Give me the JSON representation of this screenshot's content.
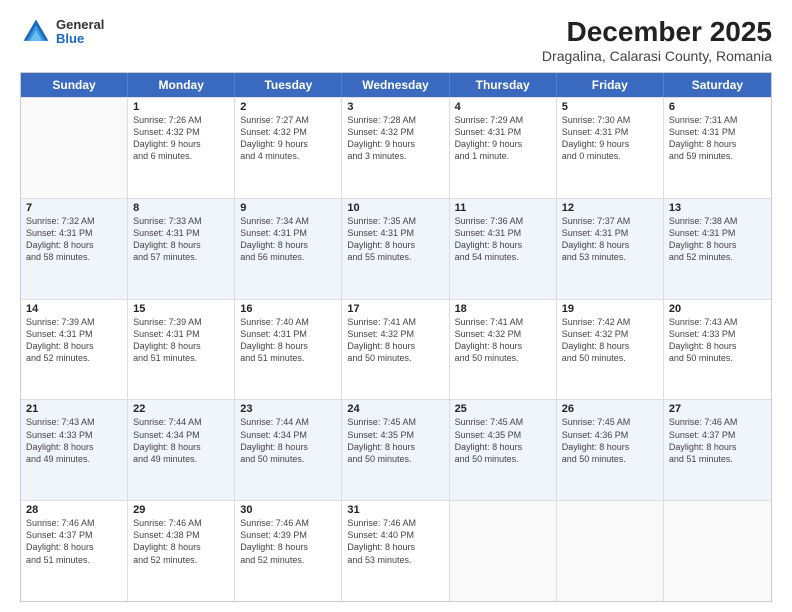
{
  "logo": {
    "general": "General",
    "blue": "Blue"
  },
  "title": "December 2025",
  "subtitle": "Dragalina, Calarasi County, Romania",
  "calendar": {
    "headers": [
      "Sunday",
      "Monday",
      "Tuesday",
      "Wednesday",
      "Thursday",
      "Friday",
      "Saturday"
    ],
    "rows": [
      [
        {
          "day": "",
          "lines": []
        },
        {
          "day": "1",
          "lines": [
            "Sunrise: 7:26 AM",
            "Sunset: 4:32 PM",
            "Daylight: 9 hours",
            "and 6 minutes."
          ]
        },
        {
          "day": "2",
          "lines": [
            "Sunrise: 7:27 AM",
            "Sunset: 4:32 PM",
            "Daylight: 9 hours",
            "and 4 minutes."
          ]
        },
        {
          "day": "3",
          "lines": [
            "Sunrise: 7:28 AM",
            "Sunset: 4:32 PM",
            "Daylight: 9 hours",
            "and 3 minutes."
          ]
        },
        {
          "day": "4",
          "lines": [
            "Sunrise: 7:29 AM",
            "Sunset: 4:31 PM",
            "Daylight: 9 hours",
            "and 1 minute."
          ]
        },
        {
          "day": "5",
          "lines": [
            "Sunrise: 7:30 AM",
            "Sunset: 4:31 PM",
            "Daylight: 9 hours",
            "and 0 minutes."
          ]
        },
        {
          "day": "6",
          "lines": [
            "Sunrise: 7:31 AM",
            "Sunset: 4:31 PM",
            "Daylight: 8 hours",
            "and 59 minutes."
          ]
        }
      ],
      [
        {
          "day": "7",
          "lines": [
            "Sunrise: 7:32 AM",
            "Sunset: 4:31 PM",
            "Daylight: 8 hours",
            "and 58 minutes."
          ]
        },
        {
          "day": "8",
          "lines": [
            "Sunrise: 7:33 AM",
            "Sunset: 4:31 PM",
            "Daylight: 8 hours",
            "and 57 minutes."
          ]
        },
        {
          "day": "9",
          "lines": [
            "Sunrise: 7:34 AM",
            "Sunset: 4:31 PM",
            "Daylight: 8 hours",
            "and 56 minutes."
          ]
        },
        {
          "day": "10",
          "lines": [
            "Sunrise: 7:35 AM",
            "Sunset: 4:31 PM",
            "Daylight: 8 hours",
            "and 55 minutes."
          ]
        },
        {
          "day": "11",
          "lines": [
            "Sunrise: 7:36 AM",
            "Sunset: 4:31 PM",
            "Daylight: 8 hours",
            "and 54 minutes."
          ]
        },
        {
          "day": "12",
          "lines": [
            "Sunrise: 7:37 AM",
            "Sunset: 4:31 PM",
            "Daylight: 8 hours",
            "and 53 minutes."
          ]
        },
        {
          "day": "13",
          "lines": [
            "Sunrise: 7:38 AM",
            "Sunset: 4:31 PM",
            "Daylight: 8 hours",
            "and 52 minutes."
          ]
        }
      ],
      [
        {
          "day": "14",
          "lines": [
            "Sunrise: 7:39 AM",
            "Sunset: 4:31 PM",
            "Daylight: 8 hours",
            "and 52 minutes."
          ]
        },
        {
          "day": "15",
          "lines": [
            "Sunrise: 7:39 AM",
            "Sunset: 4:31 PM",
            "Daylight: 8 hours",
            "and 51 minutes."
          ]
        },
        {
          "day": "16",
          "lines": [
            "Sunrise: 7:40 AM",
            "Sunset: 4:31 PM",
            "Daylight: 8 hours",
            "and 51 minutes."
          ]
        },
        {
          "day": "17",
          "lines": [
            "Sunrise: 7:41 AM",
            "Sunset: 4:32 PM",
            "Daylight: 8 hours",
            "and 50 minutes."
          ]
        },
        {
          "day": "18",
          "lines": [
            "Sunrise: 7:41 AM",
            "Sunset: 4:32 PM",
            "Daylight: 8 hours",
            "and 50 minutes."
          ]
        },
        {
          "day": "19",
          "lines": [
            "Sunrise: 7:42 AM",
            "Sunset: 4:32 PM",
            "Daylight: 8 hours",
            "and 50 minutes."
          ]
        },
        {
          "day": "20",
          "lines": [
            "Sunrise: 7:43 AM",
            "Sunset: 4:33 PM",
            "Daylight: 8 hours",
            "and 50 minutes."
          ]
        }
      ],
      [
        {
          "day": "21",
          "lines": [
            "Sunrise: 7:43 AM",
            "Sunset: 4:33 PM",
            "Daylight: 8 hours",
            "and 49 minutes."
          ]
        },
        {
          "day": "22",
          "lines": [
            "Sunrise: 7:44 AM",
            "Sunset: 4:34 PM",
            "Daylight: 8 hours",
            "and 49 minutes."
          ]
        },
        {
          "day": "23",
          "lines": [
            "Sunrise: 7:44 AM",
            "Sunset: 4:34 PM",
            "Daylight: 8 hours",
            "and 50 minutes."
          ]
        },
        {
          "day": "24",
          "lines": [
            "Sunrise: 7:45 AM",
            "Sunset: 4:35 PM",
            "Daylight: 8 hours",
            "and 50 minutes."
          ]
        },
        {
          "day": "25",
          "lines": [
            "Sunrise: 7:45 AM",
            "Sunset: 4:35 PM",
            "Daylight: 8 hours",
            "and 50 minutes."
          ]
        },
        {
          "day": "26",
          "lines": [
            "Sunrise: 7:45 AM",
            "Sunset: 4:36 PM",
            "Daylight: 8 hours",
            "and 50 minutes."
          ]
        },
        {
          "day": "27",
          "lines": [
            "Sunrise: 7:46 AM",
            "Sunset: 4:37 PM",
            "Daylight: 8 hours",
            "and 51 minutes."
          ]
        }
      ],
      [
        {
          "day": "28",
          "lines": [
            "Sunrise: 7:46 AM",
            "Sunset: 4:37 PM",
            "Daylight: 8 hours",
            "and 51 minutes."
          ]
        },
        {
          "day": "29",
          "lines": [
            "Sunrise: 7:46 AM",
            "Sunset: 4:38 PM",
            "Daylight: 8 hours",
            "and 52 minutes."
          ]
        },
        {
          "day": "30",
          "lines": [
            "Sunrise: 7:46 AM",
            "Sunset: 4:39 PM",
            "Daylight: 8 hours",
            "and 52 minutes."
          ]
        },
        {
          "day": "31",
          "lines": [
            "Sunrise: 7:46 AM",
            "Sunset: 4:40 PM",
            "Daylight: 8 hours",
            "and 53 minutes."
          ]
        },
        {
          "day": "",
          "lines": []
        },
        {
          "day": "",
          "lines": []
        },
        {
          "day": "",
          "lines": []
        }
      ]
    ]
  }
}
